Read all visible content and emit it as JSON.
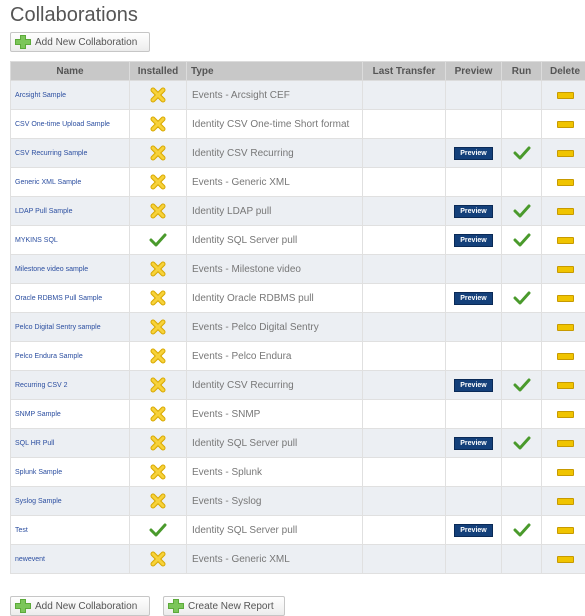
{
  "page": {
    "title": "Collaborations",
    "add_button": "Add New Collaboration",
    "bottom_add_button": "Add New Collaboration",
    "report_button": "Create New Report"
  },
  "table": {
    "headers": [
      "Name",
      "Installed",
      "Type",
      "Last Transfer",
      "Preview",
      "Run",
      "Delete"
    ],
    "preview_label": "Preview",
    "rows": [
      {
        "name": "Arcsight Sample",
        "installed": false,
        "type": "Events - Arcsight CEF",
        "last_transfer": "",
        "preview": false,
        "run": false
      },
      {
        "name": "CSV One-time Upload Sample",
        "installed": false,
        "type": "Identity CSV One-time Short format",
        "last_transfer": "",
        "preview": false,
        "run": false
      },
      {
        "name": "CSV Recurring Sample",
        "installed": false,
        "type": "Identity CSV Recurring",
        "last_transfer": "",
        "preview": true,
        "run": true
      },
      {
        "name": "Generic XML Sample",
        "installed": false,
        "type": "Events - Generic XML",
        "last_transfer": "",
        "preview": false,
        "run": false
      },
      {
        "name": "LDAP Pull Sample",
        "installed": false,
        "type": "Identity LDAP pull",
        "last_transfer": "",
        "preview": true,
        "run": true
      },
      {
        "name": "MYKINS SQL",
        "installed": true,
        "type": "Identity SQL Server pull",
        "last_transfer": "",
        "preview": true,
        "run": true
      },
      {
        "name": "Milestone video sample",
        "installed": false,
        "type": "Events - Milestone video",
        "last_transfer": "",
        "preview": false,
        "run": false
      },
      {
        "name": "Oracle RDBMS Pull Sample",
        "installed": false,
        "type": "Identity Oracle RDBMS pull",
        "last_transfer": "",
        "preview": true,
        "run": true
      },
      {
        "name": "Pelco Digital Sentry sample",
        "installed": false,
        "type": "Events - Pelco Digital Sentry",
        "last_transfer": "",
        "preview": false,
        "run": false
      },
      {
        "name": "Pelco Endura Sample",
        "installed": false,
        "type": "Events - Pelco Endura",
        "last_transfer": "",
        "preview": false,
        "run": false
      },
      {
        "name": "Recurring CSV 2",
        "installed": false,
        "type": "Identity CSV Recurring",
        "last_transfer": "",
        "preview": true,
        "run": true
      },
      {
        "name": "SNMP Sample",
        "installed": false,
        "type": "Events - SNMP",
        "last_transfer": "",
        "preview": false,
        "run": false
      },
      {
        "name": "SQL HR Pull",
        "installed": false,
        "type": "Identity SQL Server pull",
        "last_transfer": "",
        "preview": true,
        "run": true
      },
      {
        "name": "Splunk Sample",
        "installed": false,
        "type": "Events - Splunk",
        "last_transfer": "",
        "preview": false,
        "run": false
      },
      {
        "name": "Syslog Sample",
        "installed": false,
        "type": "Events - Syslog",
        "last_transfer": "",
        "preview": false,
        "run": false
      },
      {
        "name": "Test",
        "installed": true,
        "type": "Identity SQL Server pull",
        "last_transfer": "",
        "preview": true,
        "run": true
      },
      {
        "name": "newevent",
        "installed": false,
        "type": "Events - Generic XML",
        "last_transfer": "",
        "preview": false,
        "run": false
      }
    ]
  },
  "icons": {
    "add": "plus-puzzle-icon",
    "report": "plus-puzzle-icon",
    "installed_yes": "green-check-icon",
    "installed_no": "yellow-x-icon",
    "run": "green-check-icon",
    "delete": "yellow-minus-icon"
  },
  "colors": {
    "header_bg": "#c8c8c8",
    "alt_row": "#eceff3",
    "link": "#2b4ea0",
    "preview_bg": "#14407a",
    "check": "#4a9a2c",
    "cross": "#f2c200"
  }
}
